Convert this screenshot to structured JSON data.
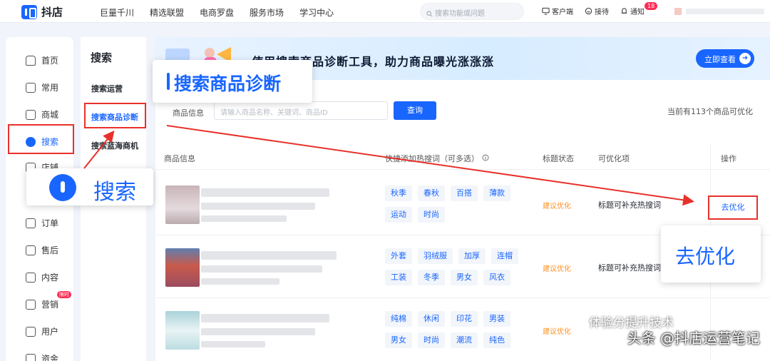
{
  "topbar": {
    "brand": "抖店",
    "nav": [
      "巨量千川",
      "精选联盟",
      "电商罗盘",
      "服务市场",
      "学习中心"
    ],
    "search_placeholder": "搜索功能或问题",
    "tools": [
      {
        "icon": "client-icon",
        "label": "客户端"
      },
      {
        "icon": "reception-icon",
        "label": "接待"
      },
      {
        "icon": "bell-icon",
        "label": "通知"
      }
    ],
    "notify_count": "18"
  },
  "sidebar": {
    "items": [
      {
        "label": "首页",
        "icon": "home-icon"
      },
      {
        "label": "常用",
        "icon": "folder-icon"
      },
      {
        "label": "商城",
        "icon": "mall-icon"
      },
      {
        "label": "搜索",
        "icon": "search-icon"
      },
      {
        "label": "店铺",
        "icon": "store-icon"
      },
      {
        "label": "订单",
        "icon": "order-icon"
      },
      {
        "label": "售后",
        "icon": "aftersale-icon"
      },
      {
        "label": "内容",
        "icon": "content-icon"
      },
      {
        "label": "营销",
        "icon": "marketing-icon"
      },
      {
        "label": "用户",
        "icon": "user-icon"
      },
      {
        "label": "资金",
        "icon": "money-icon"
      }
    ],
    "marketing_badge": "限时"
  },
  "submenu": {
    "title": "搜索",
    "items": [
      "搜索运营",
      "搜索商品诊断",
      "搜索蓝海商机"
    ]
  },
  "banner": {
    "title": "使用搜索商品诊断工具，助力商品曝光涨涨涨",
    "button": "立即查看"
  },
  "filter": {
    "label": "商品信息",
    "placeholder": "请输入商品名称、关键词、商品ID",
    "query_button": "查询",
    "count_text": "当前有113个商品可优化"
  },
  "table": {
    "headers": [
      "商品信息",
      "快捷添加热搜词（可多选）",
      "标题状态",
      "可优化项",
      "操作"
    ],
    "rows": [
      {
        "tags": [
          "秋季",
          "春秋",
          "百搭",
          "薄款",
          "运动",
          "时尚"
        ],
        "status": "建议优化",
        "optimizable": "标题可补充热搜词",
        "action": "去优化"
      },
      {
        "tags": [
          "外套",
          "羽绒服",
          "加厚",
          "连帽",
          "工装",
          "冬季",
          "男女",
          "风衣"
        ],
        "status": "建议优化",
        "optimizable": "标题可补充热搜词",
        "action": ""
      },
      {
        "tags": [
          "纯棉",
          "休闲",
          "印花",
          "男装",
          "男女",
          "时尚",
          "潮流",
          "纯色"
        ],
        "status": "建议优化",
        "optimizable": "",
        "action": ""
      }
    ]
  },
  "callouts": {
    "submenu_zoom": "搜索商品诊断",
    "sidebar_zoom": "搜索",
    "action_zoom": "去优化"
  },
  "watermark": {
    "line1": "体验分提升技术",
    "line2": "头条 @抖店运营笔记"
  },
  "colors": {
    "accent": "#1966ff",
    "warning": "#ff8f1f",
    "highlight": "#e8312a"
  }
}
